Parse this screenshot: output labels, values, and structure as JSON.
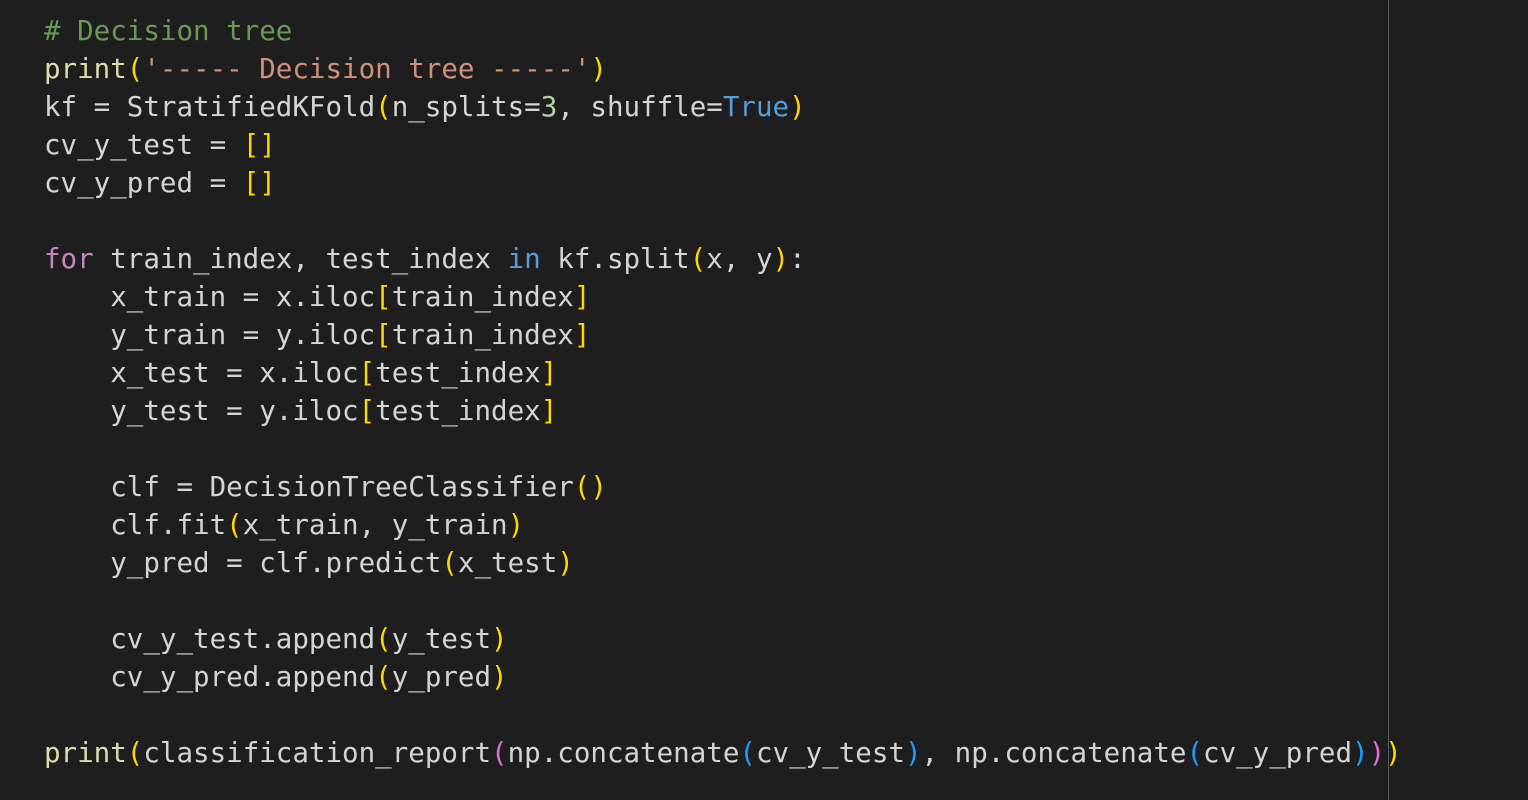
{
  "editor": {
    "language": "python",
    "colors": {
      "background": "#1e1e1e",
      "comment": "#6a9955",
      "function": "#dcdcaa",
      "string": "#ce9178",
      "keyword": "#c586c0",
      "builtin_constant": "#569cd6",
      "number": "#b5cea8",
      "default_text": "#d4d4d4",
      "bracket_level1": "#ffd700",
      "bracket_level2": "#da70d6",
      "bracket_level3": "#179fff"
    },
    "lines": [
      [
        {
          "t": "cm",
          "v": "# Decision tree"
        }
      ],
      [
        {
          "t": "fn",
          "v": "print"
        },
        {
          "t": "b1",
          "v": "("
        },
        {
          "t": "st",
          "v": "'----- Decision tree -----'"
        },
        {
          "t": "b1",
          "v": ")"
        }
      ],
      [
        {
          "t": "tx",
          "v": "kf = StratifiedKFold"
        },
        {
          "t": "b1",
          "v": "("
        },
        {
          "t": "tx",
          "v": "n_splits="
        },
        {
          "t": "nm",
          "v": "3"
        },
        {
          "t": "tx",
          "v": ", shuffle="
        },
        {
          "t": "bi",
          "v": "True"
        },
        {
          "t": "b1",
          "v": ")"
        }
      ],
      [
        {
          "t": "tx",
          "v": "cv_y_test = "
        },
        {
          "t": "b1",
          "v": "[]"
        }
      ],
      [
        {
          "t": "tx",
          "v": "cv_y_pred = "
        },
        {
          "t": "b1",
          "v": "[]"
        }
      ],
      [],
      [
        {
          "t": "kw",
          "v": "for"
        },
        {
          "t": "tx",
          "v": " train_index, test_index "
        },
        {
          "t": "bi",
          "v": "in"
        },
        {
          "t": "tx",
          "v": " kf.split"
        },
        {
          "t": "b1",
          "v": "("
        },
        {
          "t": "tx",
          "v": "x, y"
        },
        {
          "t": "b1",
          "v": ")"
        },
        {
          "t": "tx",
          "v": ":"
        }
      ],
      [
        {
          "t": "tx",
          "v": "    x_train = x.iloc"
        },
        {
          "t": "b1",
          "v": "["
        },
        {
          "t": "tx",
          "v": "train_index"
        },
        {
          "t": "b1",
          "v": "]"
        }
      ],
      [
        {
          "t": "tx",
          "v": "    y_train = y.iloc"
        },
        {
          "t": "b1",
          "v": "["
        },
        {
          "t": "tx",
          "v": "train_index"
        },
        {
          "t": "b1",
          "v": "]"
        }
      ],
      [
        {
          "t": "tx",
          "v": "    x_test = x.iloc"
        },
        {
          "t": "b1",
          "v": "["
        },
        {
          "t": "tx",
          "v": "test_index"
        },
        {
          "t": "b1",
          "v": "]"
        }
      ],
      [
        {
          "t": "tx",
          "v": "    y_test = y.iloc"
        },
        {
          "t": "b1",
          "v": "["
        },
        {
          "t": "tx",
          "v": "test_index"
        },
        {
          "t": "b1",
          "v": "]"
        }
      ],
      [],
      [
        {
          "t": "tx",
          "v": "    clf = DecisionTreeClassifier"
        },
        {
          "t": "b1",
          "v": "()"
        }
      ],
      [
        {
          "t": "tx",
          "v": "    clf.fit"
        },
        {
          "t": "b1",
          "v": "("
        },
        {
          "t": "tx",
          "v": "x_train, y_train"
        },
        {
          "t": "b1",
          "v": ")"
        }
      ],
      [
        {
          "t": "tx",
          "v": "    y_pred = clf.predict"
        },
        {
          "t": "b1",
          "v": "("
        },
        {
          "t": "tx",
          "v": "x_test"
        },
        {
          "t": "b1",
          "v": ")"
        }
      ],
      [],
      [
        {
          "t": "tx",
          "v": "    cv_y_test.append"
        },
        {
          "t": "b1",
          "v": "("
        },
        {
          "t": "tx",
          "v": "y_test"
        },
        {
          "t": "b1",
          "v": ")"
        }
      ],
      [
        {
          "t": "tx",
          "v": "    cv_y_pred.append"
        },
        {
          "t": "b1",
          "v": "("
        },
        {
          "t": "tx",
          "v": "y_pred"
        },
        {
          "t": "b1",
          "v": ")"
        }
      ],
      [],
      [
        {
          "t": "fn",
          "v": "print"
        },
        {
          "t": "b1",
          "v": "("
        },
        {
          "t": "tx",
          "v": "classification_report"
        },
        {
          "t": "b2",
          "v": "("
        },
        {
          "t": "tx",
          "v": "np.concatenate"
        },
        {
          "t": "b3",
          "v": "("
        },
        {
          "t": "tx",
          "v": "cv_y_test"
        },
        {
          "t": "b3",
          "v": ")"
        },
        {
          "t": "tx",
          "v": ", np.concatenate"
        },
        {
          "t": "b3",
          "v": "("
        },
        {
          "t": "tx",
          "v": "cv_y_pred"
        },
        {
          "t": "b3",
          "v": ")"
        },
        {
          "t": "b2",
          "v": ")"
        },
        {
          "t": "b1",
          "v": ")"
        }
      ]
    ]
  }
}
